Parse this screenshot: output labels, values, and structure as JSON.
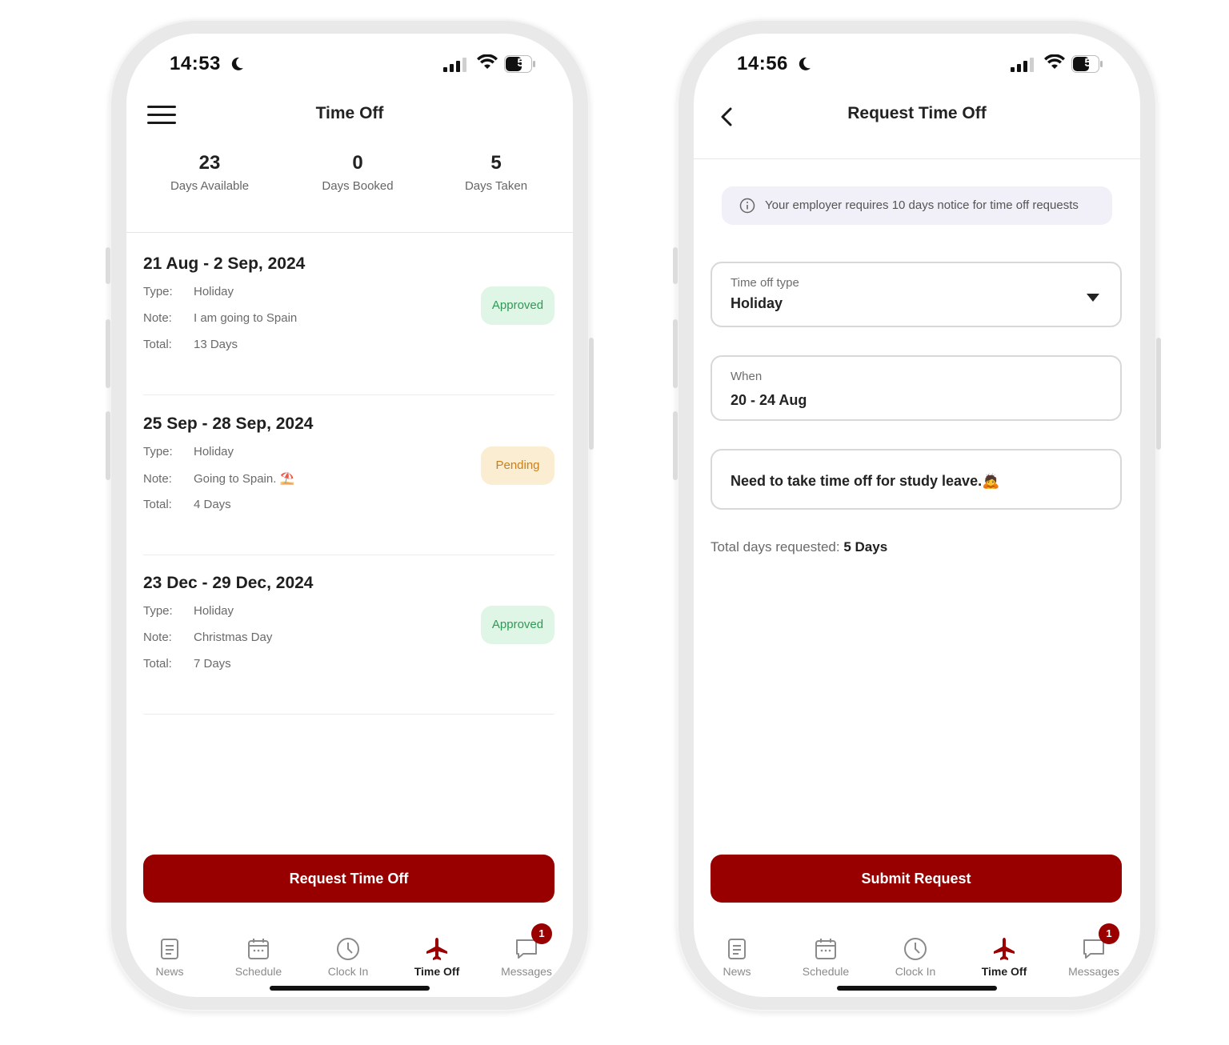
{
  "left_screen": {
    "status": {
      "time": "14:53",
      "battery": "58"
    },
    "title": "Time Off",
    "stats": [
      {
        "value": "23",
        "label": "Days Available"
      },
      {
        "value": "0",
        "label": "Days Booked"
      },
      {
        "value": "5",
        "label": "Days Taken"
      }
    ],
    "requests": [
      {
        "range": "21 Aug - 2 Sep, 2024",
        "type_key": "Type:",
        "type": "Holiday",
        "note_key": "Note:",
        "note": "I am going to Spain",
        "total_key": "Total:",
        "total": "13 Days",
        "status": "Approved"
      },
      {
        "range": "25 Sep - 28 Sep, 2024",
        "type_key": "Type:",
        "type": "Holiday",
        "note_key": "Note:",
        "note": "Going to Spain. ⛱️",
        "total_key": "Total:",
        "total": "4 Days",
        "status": "Pending"
      },
      {
        "range": "23 Dec - 29 Dec, 2024",
        "type_key": "Type:",
        "type": "Holiday",
        "note_key": "Note:",
        "note": "Christmas Day",
        "total_key": "Total:",
        "total": "7 Days",
        "status": "Approved"
      }
    ],
    "primary_button": "Request Time Off"
  },
  "right_screen": {
    "status": {
      "time": "14:56",
      "battery": "57"
    },
    "title": "Request Time Off",
    "notice": "Your employer requires 10 days notice for time off requests",
    "type_field": {
      "label": "Time off type",
      "value": "Holiday"
    },
    "when_field": {
      "label": "When",
      "value": "20 - 24 Aug"
    },
    "note_field": {
      "value": "Need to take time off for study leave.🙇"
    },
    "total_label": "Total days requested:",
    "total_value": "5 Days",
    "primary_button": "Submit Request"
  },
  "tabs": [
    {
      "label": "News",
      "icon": "news-icon"
    },
    {
      "label": "Schedule",
      "icon": "calendar-icon"
    },
    {
      "label": "Clock In",
      "icon": "clock-icon"
    },
    {
      "label": "Time Off",
      "icon": "airplane-icon"
    },
    {
      "label": "Messages",
      "icon": "message-icon",
      "badge": "1"
    }
  ],
  "colors": {
    "brand": "#980000",
    "approved_bg": "#dff5e6",
    "approved_text": "#2f9a55",
    "pending_bg": "#fbedd2",
    "pending_text": "#c97f1a"
  }
}
